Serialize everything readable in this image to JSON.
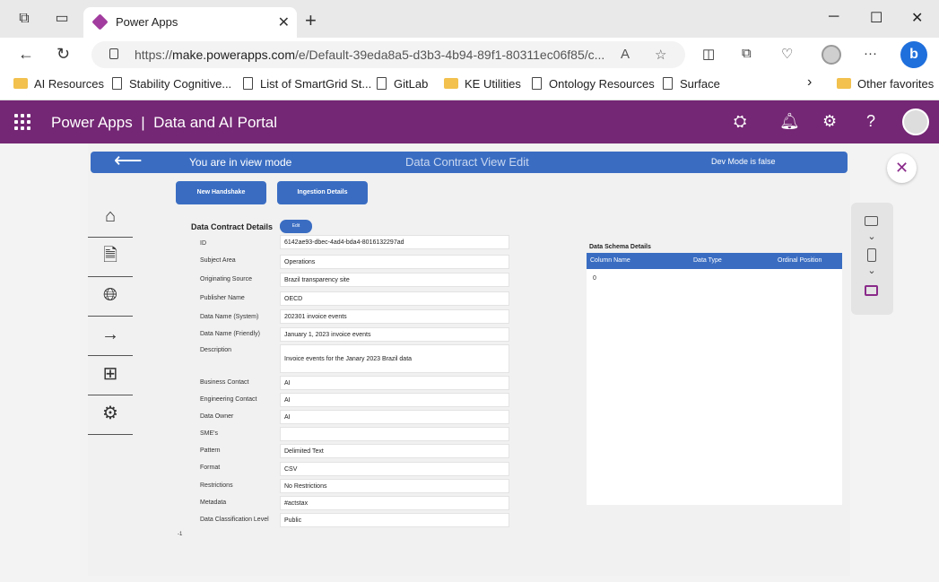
{
  "browser": {
    "tab_title": "Power Apps",
    "url_host": "make.powerapps.com",
    "url_prefix": "https://",
    "url_path": "/e/Default-39eda8a5-d3b3-4b94-89f1-80311ec06f85/c...",
    "favorites": [
      {
        "label": "AI Resources",
        "icon": "folder-icon"
      },
      {
        "label": "Stability Cognitive...",
        "icon": "page-icon"
      },
      {
        "label": "List of SmartGrid St...",
        "icon": "page-icon"
      },
      {
        "label": "GitLab",
        "icon": "folder-icon"
      },
      {
        "label": "KE Utilities",
        "icon": "folder-icon"
      },
      {
        "label": "Ontology Resources",
        "icon": "page-icon"
      },
      {
        "label": "Surface",
        "icon": "page-icon"
      }
    ],
    "other_favorites": "Other favorites"
  },
  "header": {
    "product": "Power Apps",
    "separator": "|",
    "environment": "Data and AI Portal"
  },
  "app": {
    "view_mode": "You are in view mode",
    "title": "Data Contract View Edit",
    "dev_mode": "Dev Mode is false",
    "new_handshake": "New Handshake",
    "ingestion_details": "Ingestion Details",
    "section_title": "Data Contract Details",
    "edit": "Edit",
    "fields": [
      {
        "label": "ID",
        "value": "6142ae93-dbec-4ad4-bda4-8016132297ad"
      },
      {
        "label": "Subject Area",
        "value": "Operations"
      },
      {
        "label": "Originating Source",
        "value": "Brazil transparency site"
      },
      {
        "label": "Publisher Name",
        "value": "OECD"
      },
      {
        "label": "Data Name (System)",
        "value": "202301 invoice events"
      },
      {
        "label": "Data Name (Friendly)",
        "value": "January 1, 2023 invoice events"
      },
      {
        "label": "Description",
        "value": "Invoice events for the Janary 2023 Brazil data"
      },
      {
        "label": "Business Contact",
        "value": "AI"
      },
      {
        "label": "Engineering Contact",
        "value": "AI"
      },
      {
        "label": "Data Owner",
        "value": "AI"
      },
      {
        "label": "SME's",
        "value": ""
      },
      {
        "label": "Pattern",
        "value": "Delimited Text"
      },
      {
        "label": "Format",
        "value": "CSV"
      },
      {
        "label": "Restrictions",
        "value": "No Restrictions"
      },
      {
        "label": "Metadata",
        "value": "#actstax"
      },
      {
        "label": "Data Classification Level",
        "value": "Public"
      }
    ],
    "tiny_mark": "-1",
    "schema": {
      "title": "Data Schema Details",
      "columns": [
        "Column Name",
        "Data Type",
        "Ordinal Position"
      ],
      "first_cell": "0"
    }
  },
  "colors": {
    "header_purple": "#742774",
    "app_blue": "#3a6dc2"
  }
}
